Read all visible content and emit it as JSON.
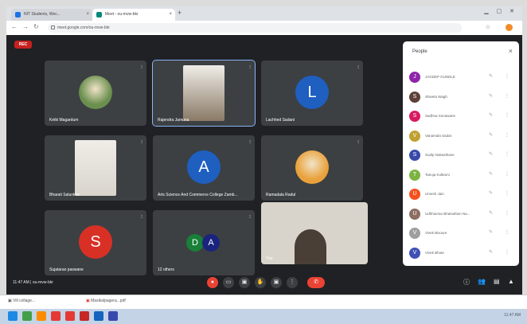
{
  "browser": {
    "tabs": [
      {
        "label": "NIT Students, Wec...",
        "fav_color": "#1a73e8"
      },
      {
        "label": "Meet - ou-mvw-bkr",
        "fav_color": "#00897b"
      }
    ],
    "new_tab": "+",
    "address": "meet.google.com/ou-mvw-bkr"
  },
  "meeting": {
    "rec_label": "REC",
    "clock": "11:47 AM | ou-mvw-bkr",
    "tiles": [
      {
        "name": "Ketki Magardum",
        "kind": "photo",
        "color": "#6a8f4e"
      },
      {
        "name": "Rajendra Jamuna",
        "kind": "video",
        "color": "#8a7a66"
      },
      {
        "name": "Lachhed Sadani",
        "kind": "letter",
        "letter": "L",
        "color": "#1e5fc0"
      },
      {
        "name": "Bharati Salunkhe",
        "kind": "video",
        "color": "#d8d4cc"
      },
      {
        "name": "Arts Science And Commerce College Zamb...",
        "kind": "letter",
        "letter": "A",
        "color": "#1e5fc0"
      },
      {
        "name": "Ramadala Radul",
        "kind": "photo",
        "color": "#e9a23b"
      },
      {
        "name": "Sujatarao paswane",
        "kind": "letter",
        "letter": "S",
        "color": "#d93025"
      },
      {
        "name": "12 others",
        "kind": "group",
        "letters": [
          "D",
          "A"
        ],
        "colors": [
          "#188038",
          "#1a237e"
        ]
      },
      {
        "name": "You",
        "kind": "video",
        "color": "#b5a896"
      }
    ]
  },
  "controls": {
    "mic": "●",
    "captions": "▭",
    "raise": "✋",
    "present": "▣",
    "more": "⋮",
    "end": "✆"
  },
  "people_panel": {
    "title": "People",
    "close": "×",
    "participants": [
      {
        "name": "JAGDEP GUNDLE",
        "initial": "J",
        "color": "#8e24aa"
      },
      {
        "name": "Shweta Wagh",
        "initial": "S",
        "color": "#5d4037"
      },
      {
        "name": "Sadhna Sonawane",
        "initial": "S",
        "color": "#d81b60"
      },
      {
        "name": "Vanamala Sadat",
        "initial": "V",
        "color": "#c0a030"
      },
      {
        "name": "Sudip Nakasthane",
        "initial": "S",
        "color": "#3949ab"
      },
      {
        "name": "Tanuja Kulkarni",
        "initial": "T",
        "color": "#7cb342"
      },
      {
        "name": "Umesh Jain",
        "initial": "U",
        "color": "#f4511e"
      },
      {
        "name": "Udhhavrao Bhaisahtun Na...",
        "initial": "U",
        "color": "#8d6e63"
      },
      {
        "name": "Vivek Bisoure",
        "initial": "V",
        "color": "#9e9e9e"
      },
      {
        "name": "Vivek Bhute",
        "initial": "V",
        "color": "#3f51b5"
      }
    ]
  },
  "downloads": [
    {
      "label": "Vill collage..."
    },
    {
      "label": "Masikalpagera...pdf"
    }
  ],
  "taskbar": {
    "icon_colors": [
      "#1e88e5",
      "#43a047",
      "#fb8c00",
      "#e53935",
      "#e53935",
      "#c62828",
      "#1565c0",
      "#3949ab"
    ],
    "tray": "11:47 AM"
  }
}
